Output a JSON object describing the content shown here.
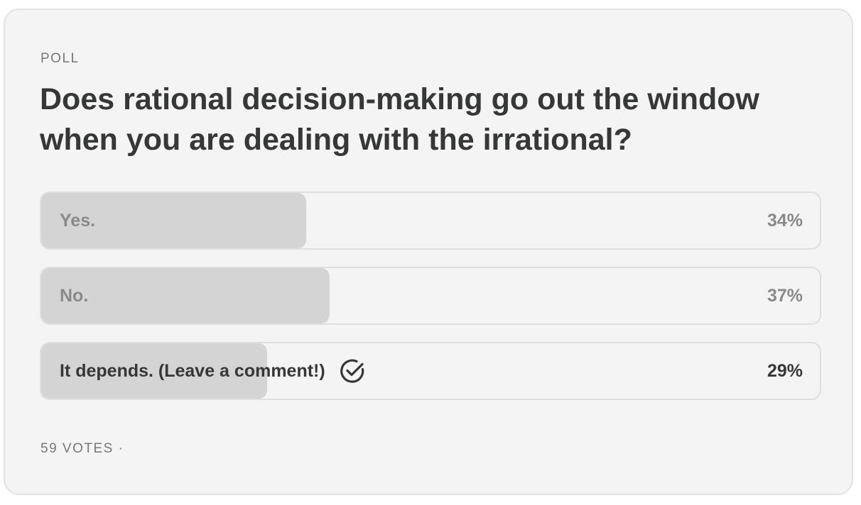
{
  "poll": {
    "label": "POLL",
    "question": "Does rational decision-making go out the window when you are dealing with the irrational?",
    "options": [
      {
        "label": "Yes.",
        "percent_text": "34%",
        "fraction": 0.34,
        "selected": false
      },
      {
        "label": "No.",
        "percent_text": "37%",
        "fraction": 0.37,
        "selected": false
      },
      {
        "label": "It depends. (Leave a comment!)",
        "percent_text": "29%",
        "fraction": 0.29,
        "selected": true,
        "icon": "check-circle-icon"
      }
    ],
    "footer": "59 VOTES ·"
  },
  "colors": {
    "card_background": "#f4f4f4",
    "bar_fill": "#d4d4d4",
    "text_dark": "#363737",
    "text_muted": "#8a8a8a"
  }
}
